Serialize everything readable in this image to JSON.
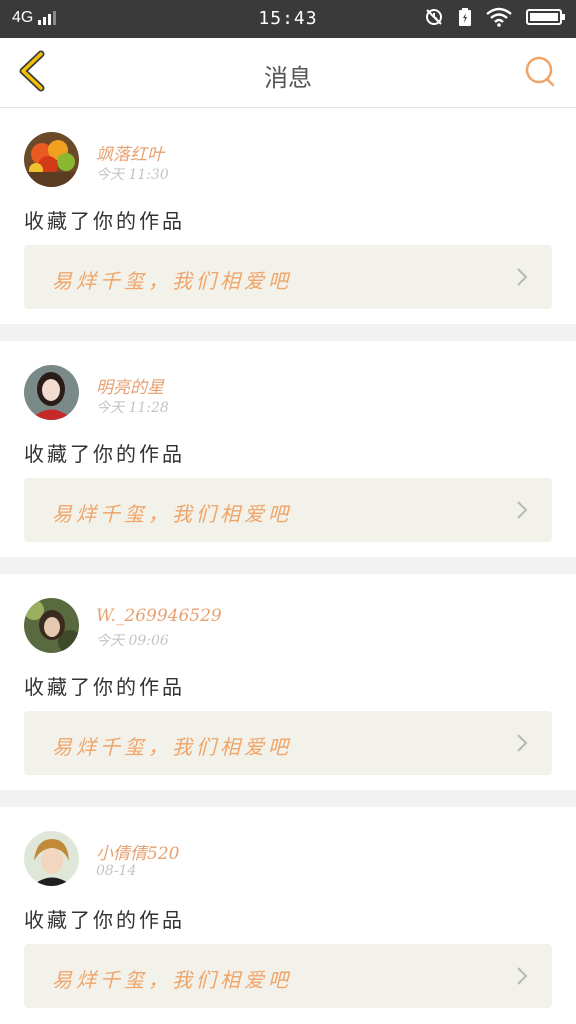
{
  "status_bar": {
    "network": "4G",
    "time": "15:43"
  },
  "header": {
    "title": "消息"
  },
  "messages": [
    {
      "user": "飒落红叶",
      "time": "今天 11:30",
      "action": "收藏了你的作品",
      "work": "易烊千玺，我们相爱吧"
    },
    {
      "user": "明亮的星",
      "time": "今天 11:28",
      "action": "收藏了你的作品",
      "work": "易烊千玺，我们相爱吧"
    },
    {
      "user": "W._269946529",
      "time": "今天 09:06",
      "action": "收藏了你的作品",
      "work": "易烊千玺，我们相爱吧"
    },
    {
      "user": "小倩倩520",
      "time": "08-14",
      "action": "收藏了你的作品",
      "work": "易烊千玺，我们相爱吧"
    }
  ],
  "icons": {
    "back": "chevron-left-icon",
    "search": "search-icon",
    "arrow": "chevron-right-icon",
    "wifi": "wifi-icon",
    "battery": "battery-icon",
    "alarm": "alarm-icon",
    "charging": "charging-icon"
  },
  "colors": {
    "accent": "#f0a468",
    "name": "#e8a070",
    "back": "#f2c200",
    "card_bg": "#f2f2ea",
    "status_bg": "#3a3a3a"
  }
}
